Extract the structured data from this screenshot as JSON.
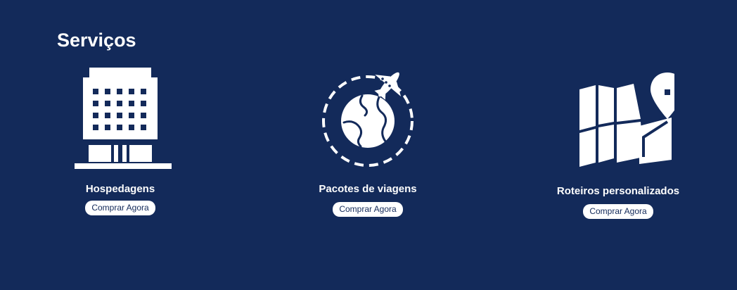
{
  "section": {
    "title": "Serviços"
  },
  "colors": {
    "background": "#132a5a",
    "foreground": "#ffffff"
  },
  "cards": [
    {
      "icon": "hotel-building-icon",
      "title": "Hospedagens",
      "button_label": "Comprar Agora"
    },
    {
      "icon": "globe-airplane-icon",
      "title": "Pacotes de viagens",
      "button_label": "Comprar Agora"
    },
    {
      "icon": "map-pin-icon",
      "title": "Roteiros personalizados",
      "button_label": "Comprar Agora"
    }
  ]
}
